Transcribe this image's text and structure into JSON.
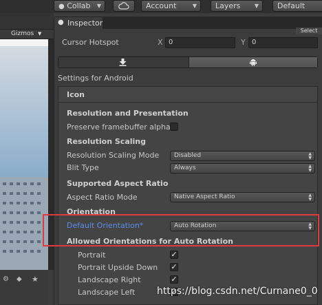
{
  "toolbar": {
    "collab_label": "Collab",
    "cloud_icon": "cloud-icon",
    "account_label": "Account",
    "layers_label": "Layers",
    "layout_label": "Default"
  },
  "scene": {
    "gizmos_label": "Gizmos"
  },
  "inspector": {
    "tab_label": "Inspector",
    "select_label": "Select",
    "cursor_hotspot": {
      "label": "Cursor Hotspot",
      "x_label": "X",
      "x_value": "0",
      "y_label": "Y",
      "y_value": "0"
    },
    "platform_tabs": [
      {
        "icon": "download-icon"
      },
      {
        "icon": "android-icon"
      }
    ],
    "settings_title": "Settings for Android",
    "icon_section": "Icon",
    "sections": {
      "resolution_presentation": "Resolution and Presentation",
      "preserve_framebuffer": "Preserve framebuffer alpha",
      "resolution_scaling": "Resolution Scaling",
      "resolution_scaling_mode": {
        "label": "Resolution Scaling Mode",
        "value": "Disabled"
      },
      "blit_type": {
        "label": "Blit Type",
        "value": "Always"
      },
      "supported_aspect_ratio": "Supported Aspect Ratio",
      "aspect_ratio_mode": {
        "label": "Aspect Ratio Mode",
        "value": "Native Aspect Ratio"
      },
      "orientation": "Orientation",
      "default_orientation": {
        "label": "Default Orientation*",
        "value": "Auto Rotation"
      },
      "allowed_orientations": "Allowed Orientations for Auto Rotation",
      "portrait": "Portrait",
      "portrait_upside_down": "Portrait Upside Down",
      "landscape_right": "Landscape Right",
      "landscape_left": "Landscape Left"
    }
  },
  "watermark": "https://blog.csdn.net/Curnane0_0",
  "colors": {
    "highlight_border": "#e0393e",
    "default_orientation_label": "#5b8fe8"
  }
}
